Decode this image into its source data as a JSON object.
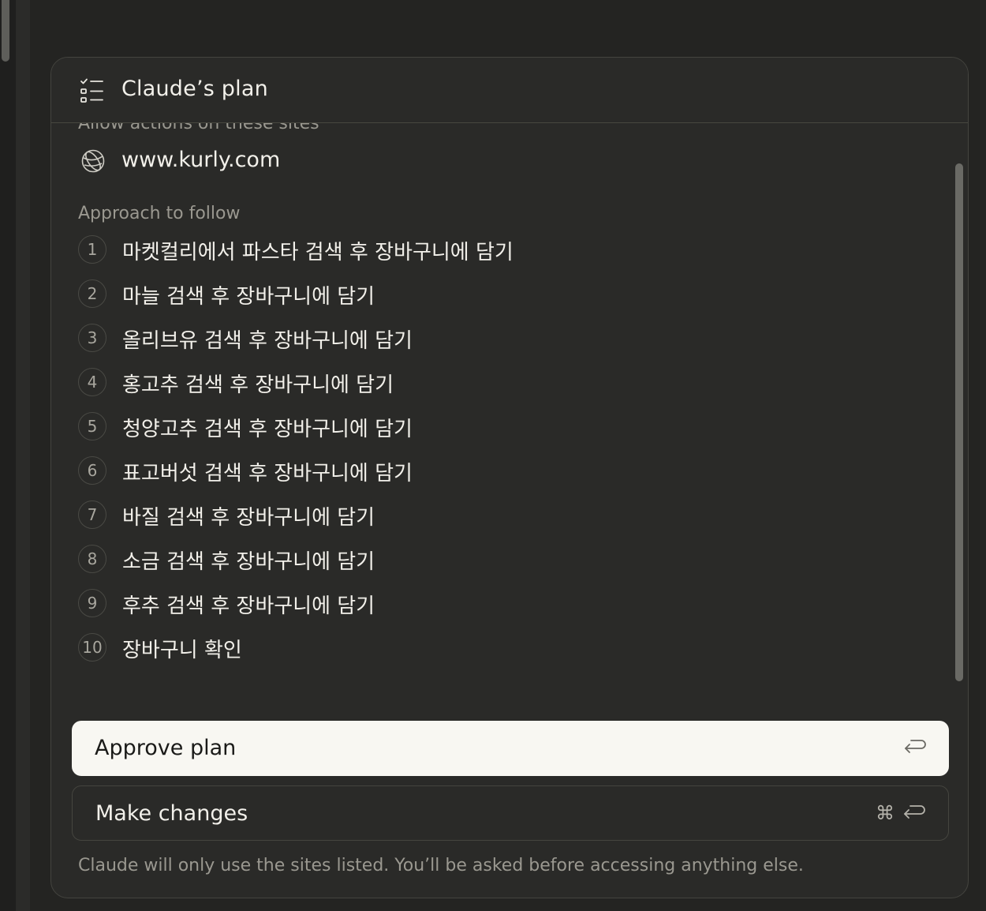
{
  "card": {
    "title": "Claude’s plan",
    "cutoff_heading": "Allow actions on these sites",
    "site": "www.kurly.com",
    "approach_heading": "Approach to follow",
    "steps": [
      {
        "num": "1",
        "text": "마켓컬리에서 파스타 검색 후 장바구니에 담기"
      },
      {
        "num": "2",
        "text": "마늘 검색 후 장바구니에 담기"
      },
      {
        "num": "3",
        "text": "올리브유 검색 후 장바구니에 담기"
      },
      {
        "num": "4",
        "text": "홍고추 검색 후 장바구니에 담기"
      },
      {
        "num": "5",
        "text": "청양고추 검색 후 장바구니에 담기"
      },
      {
        "num": "6",
        "text": "표고버섯 검색 후 장바구니에 담기"
      },
      {
        "num": "7",
        "text": "바질 검색 후 장바구니에 담기"
      },
      {
        "num": "8",
        "text": "소금 검색 후 장바구니에 담기"
      },
      {
        "num": "9",
        "text": "후추 검색 후 장바구니에 담기"
      },
      {
        "num": "10",
        "text": "장바구니 확인"
      }
    ],
    "approve_label": "Approve plan",
    "changes_label": "Make changes",
    "cmd_symbol": "⌘",
    "footer_note": "Claude will only use the sites listed. You’ll be asked before accessing anything else."
  },
  "icons": {
    "header": "checklist-icon",
    "site": "globe-icon",
    "approve": "return-key-icon",
    "changes": "command-return-icon"
  },
  "colors": {
    "card_bg": "#2a2a28",
    "approve_bg": "#f8f7f2",
    "text_primary": "#f2f0ea",
    "text_muted": "#9a9890"
  }
}
